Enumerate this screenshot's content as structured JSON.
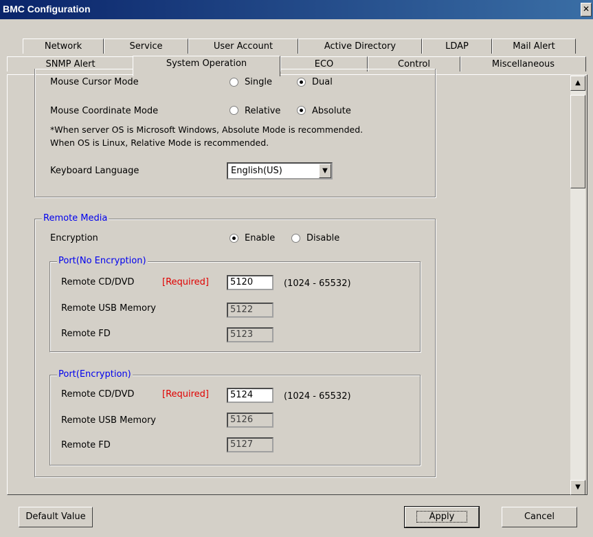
{
  "window": {
    "title": "BMC Configuration",
    "close_glyph": "✕"
  },
  "tabs_row1": [
    "Network",
    "Service",
    "User Account",
    "Active Directory",
    "LDAP",
    "Mail Alert"
  ],
  "tabs_row2": [
    "SNMP Alert",
    "System Operation",
    "ECO",
    "Control",
    "Miscellaneous"
  ],
  "active_tab": "System Operation",
  "remote_kvm": {
    "mouse_cursor_mode": {
      "label": "Mouse Cursor Mode",
      "options": [
        "Single",
        "Dual"
      ],
      "selected": "Dual"
    },
    "mouse_coordinate_mode": {
      "label": "Mouse Coordinate Mode",
      "options": [
        "Relative",
        "Absolute"
      ],
      "selected": "Absolute"
    },
    "note_line1": "*When server OS is Microsoft Windows, Absolute Mode is recommended.",
    "note_line2": "When OS is Linux, Relative Mode is recommended.",
    "keyboard_language": {
      "label": "Keyboard Language",
      "value": "English(US)"
    }
  },
  "remote_media": {
    "title": "Remote Media",
    "encryption": {
      "label": "Encryption",
      "options": [
        "Enable",
        "Disable"
      ],
      "selected": "Enable"
    },
    "port_no_enc": {
      "title": "Port(No Encryption)",
      "cd_label": "Remote CD/DVD",
      "required": "[Required]",
      "cd_value": "5120",
      "range": "(1024 - 65532)",
      "usb_label": "Remote USB Memory",
      "usb_value": "5122",
      "fd_label": "Remote FD",
      "fd_value": "5123"
    },
    "port_enc": {
      "title": "Port(Encryption)",
      "cd_label": "Remote CD/DVD",
      "required": "[Required]",
      "cd_value": "5124",
      "range": "(1024 - 65532)",
      "usb_label": "Remote USB Memory",
      "usb_value": "5126",
      "fd_label": "Remote FD",
      "fd_value": "5127"
    }
  },
  "buttons": {
    "default_value": "Default Value",
    "apply": "Apply",
    "cancel": "Cancel"
  }
}
